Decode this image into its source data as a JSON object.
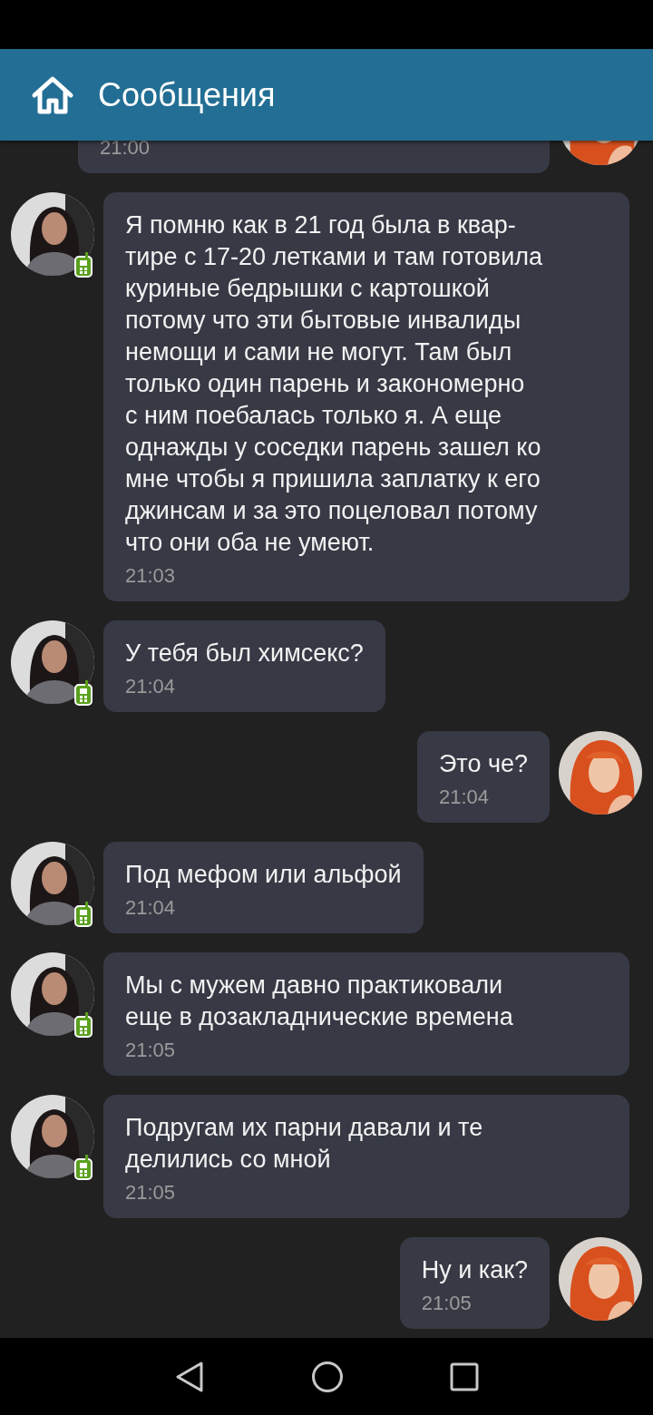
{
  "header": {
    "title": "Сообщения"
  },
  "messages": [
    {
      "kind": "outgoing",
      "time": "21:00",
      "mobile": false
    },
    {
      "kind": "incoming",
      "text": "Я помню как в 21 год была в квар-\nтире с 17-20 летками и там готовила\nкуриные бедрышки с картошкой\nпотому что эти бытовые инвалиды\nнемощи и сами не могут. Там был\nтолько один парень и закономерно\nс ним поебалась только я. А еще\nоднажды у соседки парень зашел ко\nмне чтобы я пришила заплатку к его\nджинсам и за это поцеловал потому\nчто они оба не умеют.",
      "time": "21:03",
      "mobile": true
    },
    {
      "kind": "incoming",
      "text": "У тебя был химсекс?",
      "time": "21:04",
      "mobile": true
    },
    {
      "kind": "outgoing",
      "text": "Это че?",
      "time": "21:04",
      "mobile": false
    },
    {
      "kind": "incoming",
      "text": "Под мефом или альфой",
      "time": "21:04",
      "mobile": true
    },
    {
      "kind": "incoming",
      "text": "Мы с мужем давно практиковали\nеще в дозакладнические времена",
      "time": "21:05",
      "mobile": true
    },
    {
      "kind": "incoming",
      "text": "Подругам их парни давали и те\nделились со мной",
      "time": "21:05",
      "mobile": true
    },
    {
      "kind": "outgoing",
      "text": "Ну и как?",
      "time": "21:05",
      "mobile": false
    }
  ]
}
